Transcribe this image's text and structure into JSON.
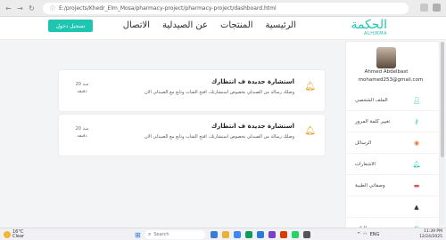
{
  "browser": {
    "url": "E:/projects/Khedr_Elm_Mosa/pharmacy-project/pharmacy-project/dashboard.html"
  },
  "header": {
    "login_button": "تسجيل دخول",
    "nav": [
      "الرئيسية",
      "المنتجات",
      "عن الصيدلية",
      "الاتصال"
    ],
    "logo_ar": "الحكمة",
    "logo_en": "ALHIKMA"
  },
  "profile": {
    "name": "Ahmed Abdelbast",
    "email": "mohamed253@gmail.com"
  },
  "sidebar": {
    "items": [
      {
        "label": "الملف الشخصي",
        "icon": "user-icon"
      },
      {
        "label": "تغيير كلمة المرور",
        "icon": "key-icon"
      },
      {
        "label": "الرسائل",
        "icon": "message-icon"
      },
      {
        "label": "الاشعارات",
        "icon": "bell-icon"
      },
      {
        "label": "وصفاتي الطبية",
        "icon": "prescription-icon"
      },
      {
        "label": "",
        "icon": "caret-up-icon"
      },
      {
        "label": "طلباتي",
        "icon": "orders-icon"
      }
    ]
  },
  "notifications": [
    {
      "title": "استشارة جديدة ف انتظارك",
      "description": "وصلك رسالة من الصيدلي بخصوص استشارتك، افتح الشات وتابع مع الصيدلي الان",
      "time_line1": "منذ 20",
      "time_line2": "دقيقه"
    },
    {
      "title": "استشارة جديدة ف انتظارك",
      "description": "وصلك رسالة من الصيدلي بخصوص استشارتك، افتح الشات وتابع مع الصيدلي الان",
      "time_line1": "منذ 20",
      "time_line2": "دقيقه"
    }
  ],
  "taskbar": {
    "weather_temp": "16°C",
    "weather_desc": "Clear",
    "search_placeholder": "Search",
    "language": "ENG",
    "time": "11:39 PM",
    "date": "12/24/2025"
  },
  "colors": {
    "accent": "#1ec6b2",
    "bell": "#e6a020"
  }
}
